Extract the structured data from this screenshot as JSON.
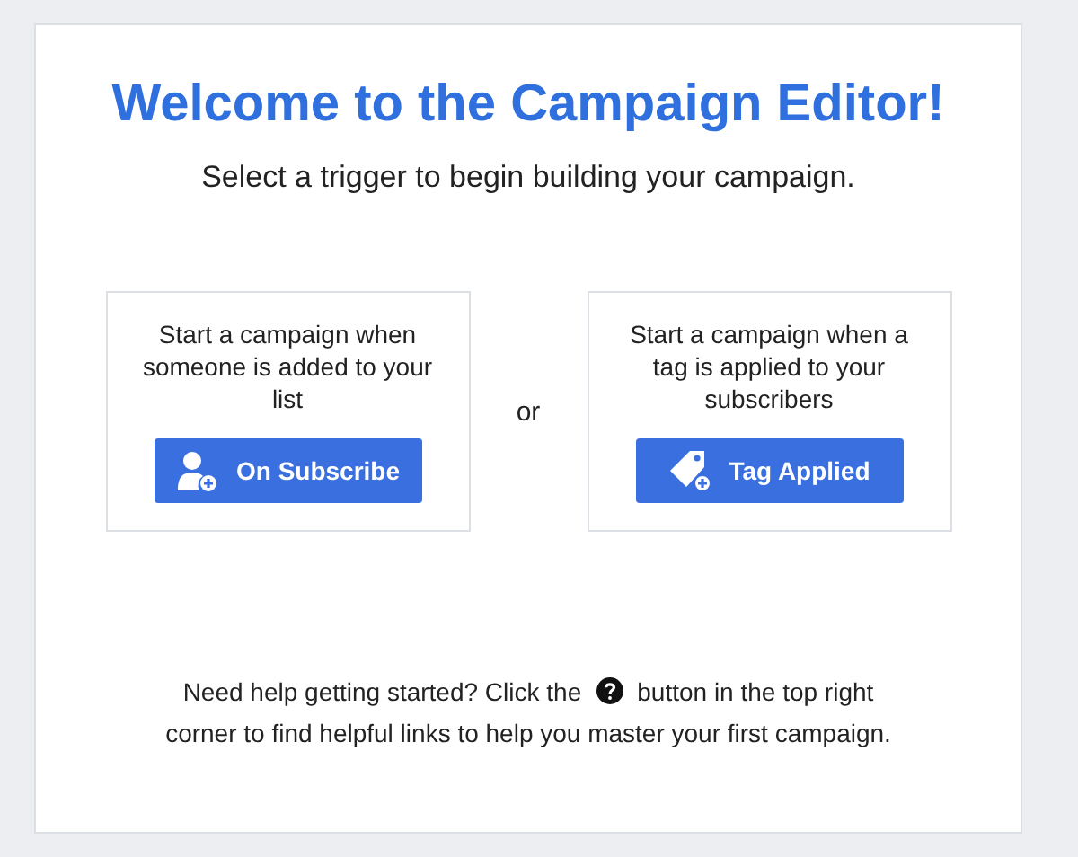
{
  "title": "Welcome to the Campaign Editor!",
  "subtitle": "Select a trigger to begin building your campaign.",
  "triggers": [
    {
      "kind": "subscribe",
      "description": "Start a campaign when someone is added to your list",
      "button": "On Subscribe"
    },
    {
      "kind": "tag",
      "description": "Start a campaign when a tag is applied to your subscribers",
      "button": "Tag Applied"
    }
  ],
  "separator": "or",
  "help": {
    "before": "Need help getting started? Click the",
    "after": "button in the top right",
    "line_2": "corner to find helpful links to help you master your first campaign."
  }
}
